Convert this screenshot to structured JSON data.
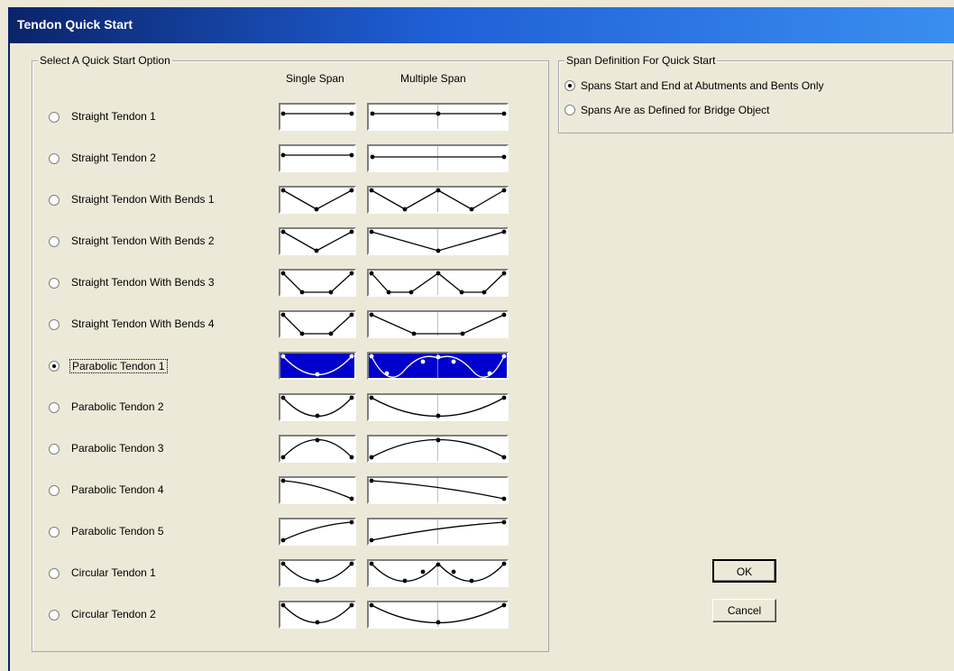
{
  "window": {
    "title": "Tendon Quick Start"
  },
  "quick_start": {
    "group_title": "Select A Quick Start Option",
    "col_single": "Single Span",
    "col_multiple": "Multiple Span",
    "selected_index": 6,
    "options": [
      {
        "label": "Straight Tendon 1",
        "single": "straight",
        "multi": "straight-mid"
      },
      {
        "label": "Straight Tendon 2",
        "single": "straight",
        "multi": "straight-plain"
      },
      {
        "label": "Straight Tendon With Bends 1",
        "single": "v",
        "multi": "vv"
      },
      {
        "label": "Straight Tendon With Bends 2",
        "single": "v",
        "multi": "v-wide"
      },
      {
        "label": "Straight Tendon With Bends 3",
        "single": "trap",
        "multi": "trap2"
      },
      {
        "label": "Straight Tendon With Bends 4",
        "single": "trap",
        "multi": "trap-wide"
      },
      {
        "label": "Parabolic Tendon 1",
        "single": "para-u",
        "multi": "para-wave"
      },
      {
        "label": "Parabolic Tendon 2",
        "single": "para-u",
        "multi": "para-u-wide"
      },
      {
        "label": "Parabolic Tendon 3",
        "single": "para-n",
        "multi": "para-n-wide"
      },
      {
        "label": "Parabolic Tendon 4",
        "single": "desc",
        "multi": "desc-wide"
      },
      {
        "label": "Parabolic Tendon 5",
        "single": "asc",
        "multi": "asc-wide"
      },
      {
        "label": "Circular Tendon 1",
        "single": "circ-u",
        "multi": "circ-uu"
      },
      {
        "label": "Circular Tendon 2",
        "single": "circ-u",
        "multi": "circ-u-wide"
      }
    ]
  },
  "span_definition": {
    "group_title": "Span Definition For Quick Start",
    "selected_index": 0,
    "options": [
      {
        "label": "Spans Start and End at Abutments and Bents Only"
      },
      {
        "label": "Spans Are as Defined for Bridge Object"
      }
    ]
  },
  "buttons": {
    "ok": "OK",
    "cancel": "Cancel"
  },
  "colors": {
    "selection": "#0000cc",
    "title_bar": "#0a246a",
    "dialog_bg": "#ece9d8"
  }
}
